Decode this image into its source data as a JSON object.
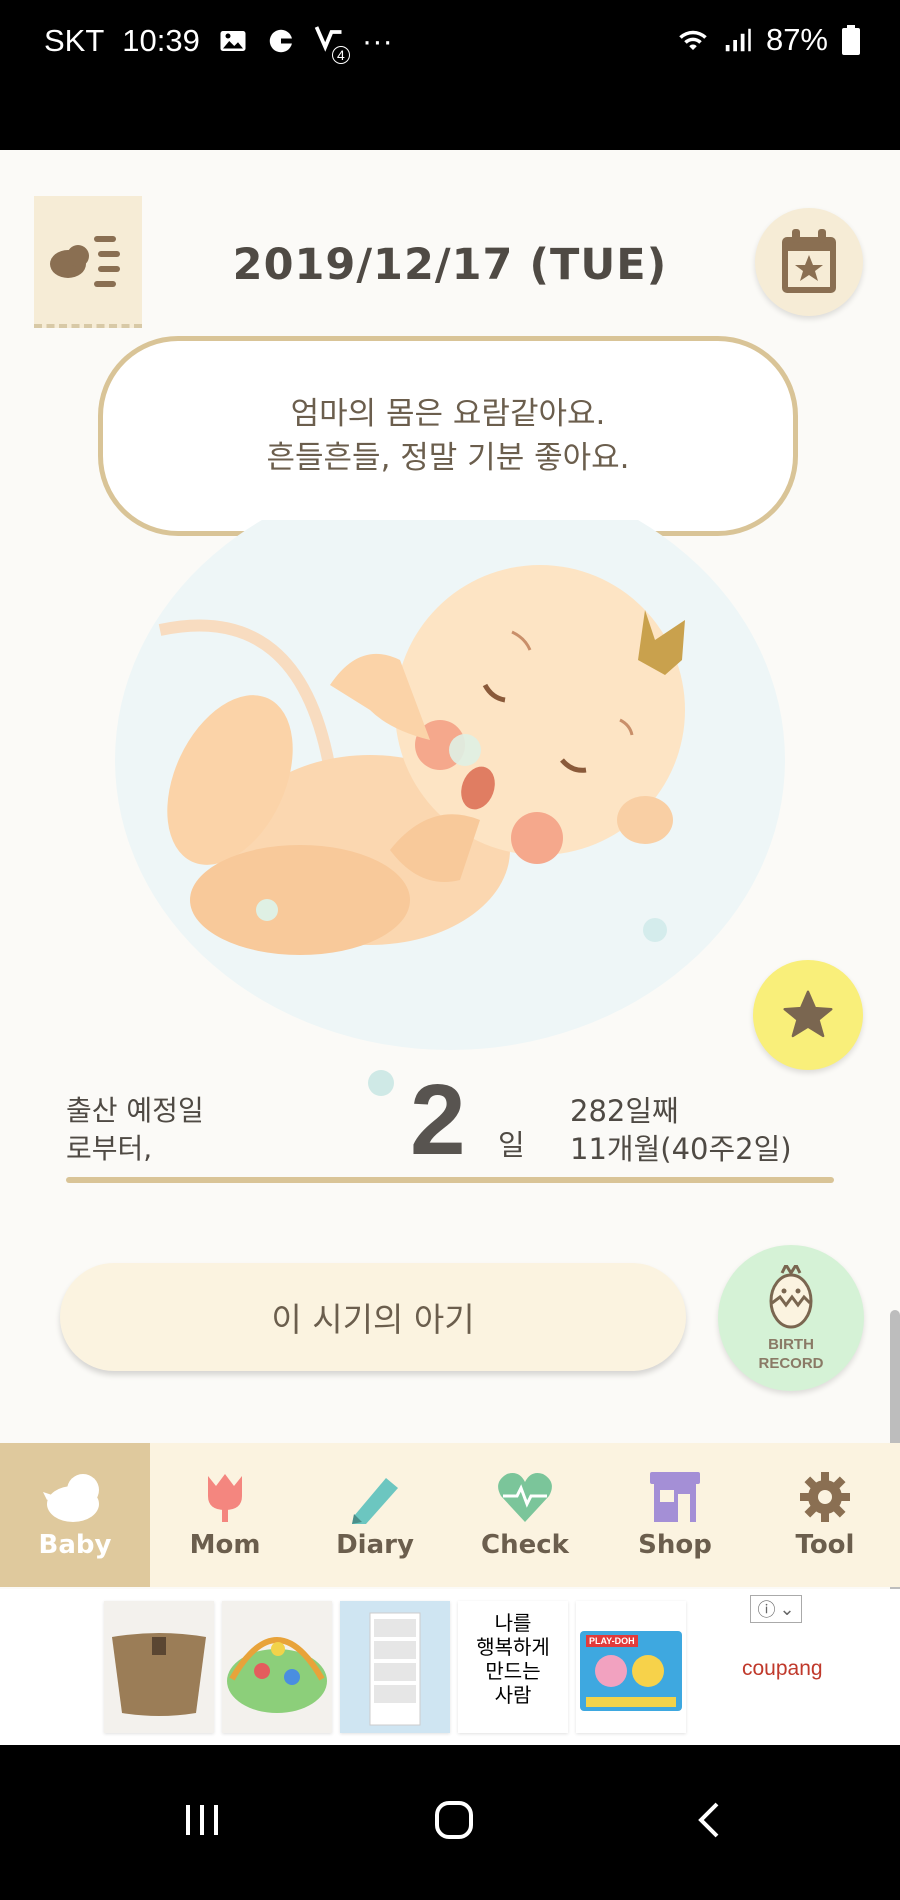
{
  "status_bar": {
    "carrier": "SKT",
    "time": "10:39",
    "battery": "87%",
    "more": "···",
    "notif_badge": "4"
  },
  "header": {
    "date": "2019/12/17 (TUE)"
  },
  "bubble": {
    "line1": "엄마의 몸은 요람같아요.",
    "line2": "흔들흔들, 정말 기분 좋아요."
  },
  "dday": {
    "label_line1": "출산 예정일",
    "label_line2": "로부터,",
    "number": "2",
    "unit": "일",
    "days": "282일째",
    "months": "11개월(40주2일)"
  },
  "period_button": {
    "label": "이 시기의 아기"
  },
  "birth_record": {
    "line1": "BIRTH",
    "line2": "RECORD"
  },
  "bottom_nav": {
    "items": [
      {
        "label": "Baby",
        "icon": "bird-icon",
        "active": true
      },
      {
        "label": "Mom",
        "icon": "tulip-icon",
        "active": false
      },
      {
        "label": "Diary",
        "icon": "pencil-icon",
        "active": false
      },
      {
        "label": "Check",
        "icon": "heart-pulse-icon",
        "active": false
      },
      {
        "label": "Shop",
        "icon": "store-icon",
        "active": false
      },
      {
        "label": "Tool",
        "icon": "gear-icon",
        "active": false
      }
    ]
  },
  "ad": {
    "brand": "coupang",
    "info": "ⓘ",
    "poster_text": [
      "나를",
      "행복하게",
      "만드는",
      "사람"
    ],
    "product_brand": "PLAY-DOH"
  },
  "colors": {
    "accent": "#d9c497",
    "active_tab": "#dfc99d",
    "favorite": "#f9ef7a",
    "birth_record": "#d5f2d6"
  }
}
